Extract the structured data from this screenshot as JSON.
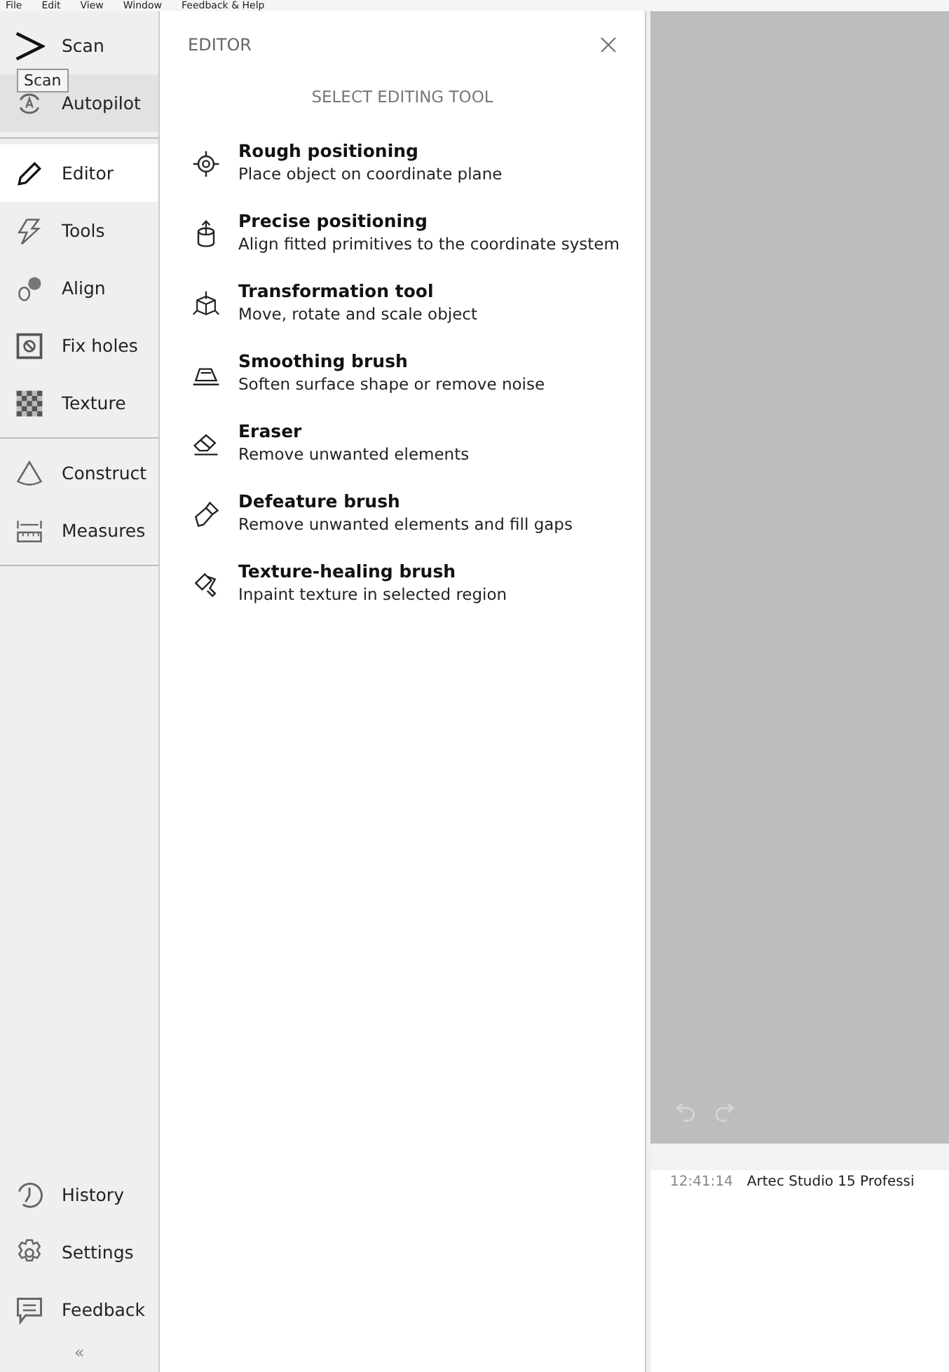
{
  "menu_bar": [
    "File",
    "Edit",
    "View",
    "Window",
    "Feedback & Help"
  ],
  "sidebar": {
    "groups": [
      [
        {
          "label": "Scan",
          "selected": false,
          "hovered": false
        },
        {
          "label": "Autopilot",
          "selected": false,
          "hovered": true
        }
      ],
      [
        {
          "label": "Editor",
          "selected": true,
          "hovered": false
        },
        {
          "label": "Tools",
          "selected": false,
          "hovered": false
        },
        {
          "label": "Align",
          "selected": false,
          "hovered": false
        },
        {
          "label": "Fix holes",
          "selected": false,
          "hovered": false
        },
        {
          "label": "Texture",
          "selected": false,
          "hovered": false
        }
      ],
      [
        {
          "label": "Construct",
          "selected": false,
          "hovered": false
        },
        {
          "label": "Measures",
          "selected": false,
          "hovered": false
        }
      ]
    ],
    "bottom": [
      {
        "label": "History",
        "selected": false,
        "hovered": false
      },
      {
        "label": "Settings",
        "selected": false,
        "hovered": false
      },
      {
        "label": "Feedback",
        "selected": false,
        "hovered": false
      }
    ],
    "collapse": "«"
  },
  "tooltip": "Scan",
  "panel": {
    "title": "EDITOR",
    "subtitle": "SELECT EDITING TOOL",
    "tools": [
      {
        "name": "Rough positioning",
        "description": "Place object on coordinate plane"
      },
      {
        "name": "Precise positioning",
        "description": "Align fitted primitives to the coordinate system"
      },
      {
        "name": "Transformation tool",
        "description": "Move, rotate and scale object"
      },
      {
        "name": "Smoothing brush",
        "description": "Soften surface shape or remove noise"
      },
      {
        "name": "Eraser",
        "description": "Remove unwanted elements"
      },
      {
        "name": "Defeature brush",
        "description": "Remove unwanted elements and fill gaps"
      },
      {
        "name": "Texture-healing brush",
        "description": "Inpaint texture in selected region"
      }
    ]
  },
  "log": [
    {
      "time": "12:41:14",
      "message": "Artec Studio 15 Professi"
    }
  ]
}
